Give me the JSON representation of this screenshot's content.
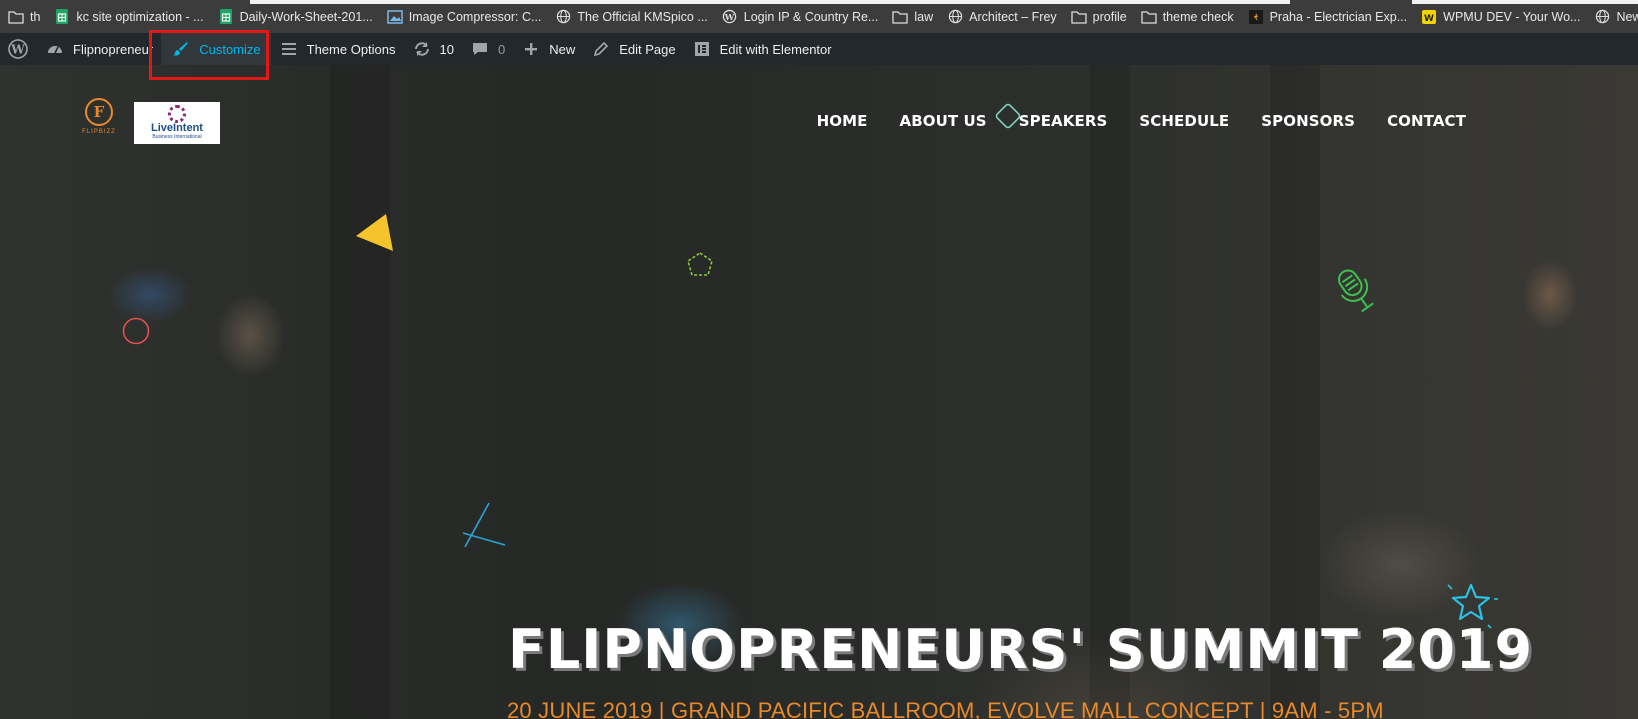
{
  "bookmarks": [
    {
      "label": "th",
      "icon": "folder-icon"
    },
    {
      "label": "kc site optimization - ...",
      "icon": "sheets-icon"
    },
    {
      "label": "Daily-Work-Sheet-201...",
      "icon": "sheets-icon"
    },
    {
      "label": "Image Compressor: C...",
      "icon": "image-icon"
    },
    {
      "label": "The Official KMSpico ...",
      "icon": "globe-icon"
    },
    {
      "label": "Login IP & Country Re...",
      "icon": "wordpress-icon"
    },
    {
      "label": "law",
      "icon": "folder-icon"
    },
    {
      "label": "Architect – Frey",
      "icon": "globe-icon"
    },
    {
      "label": "profile",
      "icon": "folder-icon"
    },
    {
      "label": "theme check",
      "icon": "folder-icon"
    },
    {
      "label": "Praha - Electrician Exp...",
      "icon": "site-icon"
    },
    {
      "label": "WPMU DEV - Your Wo...",
      "icon": "wpmudev-icon"
    },
    {
      "label": "Newspaper | The Best",
      "icon": "globe-icon"
    }
  ],
  "adminbar": {
    "site_name": "Flipnopreneur",
    "customize": "Customize",
    "theme_options": "Theme Options",
    "updates_count": "10",
    "comments_count": "0",
    "new_label": "New",
    "edit_page": "Edit Page",
    "edit_elementor": "Edit with Elementor"
  },
  "logos": {
    "flipbizz_mark": "F",
    "flipbizz_text": "FLIPBIZZ",
    "liveintent_name": "LiveIntent",
    "liveintent_sub": "Business International"
  },
  "nav": [
    "HOME",
    "ABOUT US",
    "SPEAKERS",
    "SCHEDULE",
    "SPONSORS",
    "CONTACT"
  ],
  "hero": {
    "title": "FLIPNOPRENEURS' SUMMIT 2019",
    "subtitle": "20 JUNE 2019 | GRAND PACIFIC BALLROOM, EVOLVE MALL CONCEPT | 9AM - 5PM"
  },
  "colors": {
    "accent_orange": "#e8892b",
    "admin_bar": "#23282d",
    "customize_link": "#00b9eb",
    "highlight": "#e01818"
  }
}
